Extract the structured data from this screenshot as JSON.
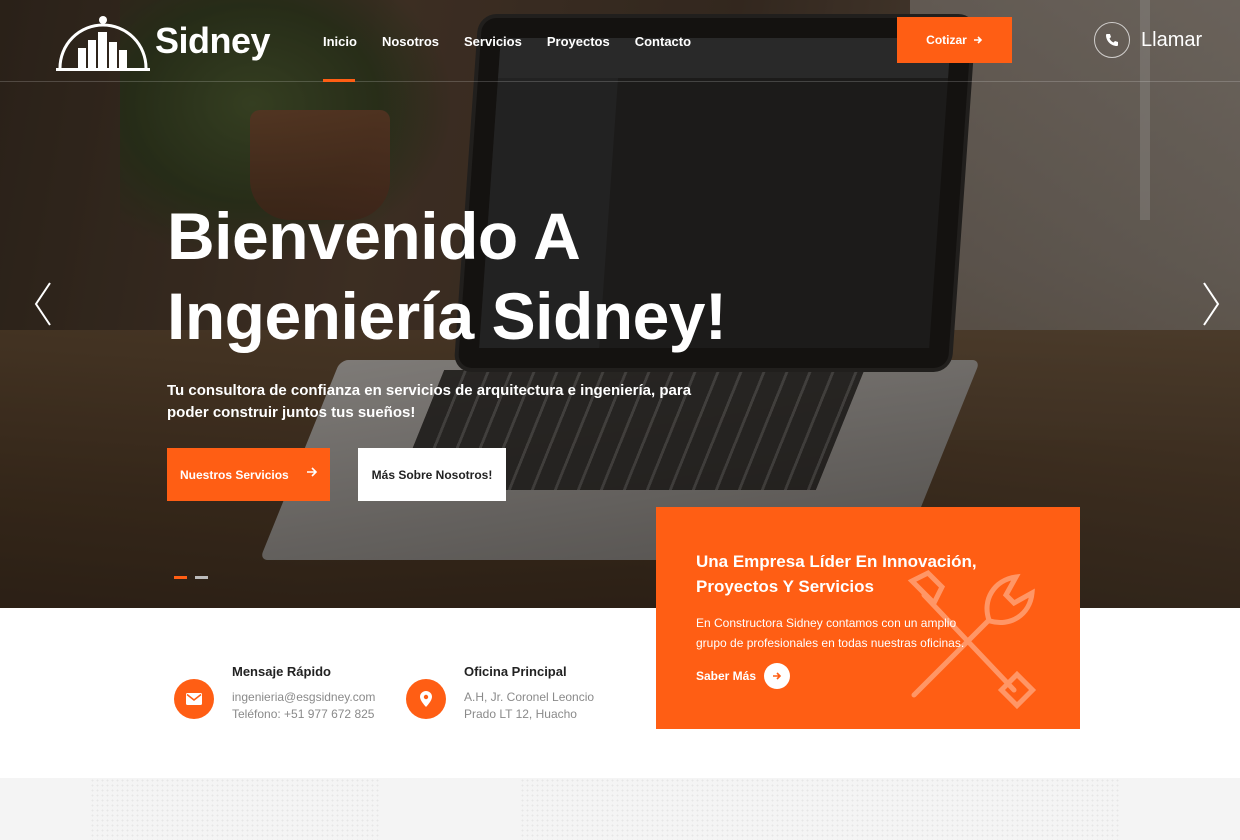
{
  "header": {
    "brand": "Sidney",
    "nav": [
      {
        "label": "Inicio",
        "active": true
      },
      {
        "label": "Nosotros",
        "active": false
      },
      {
        "label": "Servicios",
        "active": false
      },
      {
        "label": "Proyectos",
        "active": false
      },
      {
        "label": "Contacto",
        "active": false
      }
    ],
    "quote_button": "Cotizar",
    "call_label": "Llamar",
    "icons": {
      "logo": "city-skyline-logo",
      "call": "phone-icon",
      "quote_arrow": "arrow-right-icon"
    }
  },
  "hero": {
    "title_line1": "Bienvenido A",
    "title_line2": "Ingeniería Sidney!",
    "subtitle": "Tu consultora de confianza en servicios de arquitectura e ingeniería, para poder construir juntos tus sueños!",
    "primary_button": "Nuestros Servicios",
    "secondary_button": "Más Sobre Nosotros!",
    "slides_total": 2,
    "slide_active": 1
  },
  "card": {
    "title": "Una Empresa Líder En Innovación, Proyectos Y Servicios",
    "text": "En Constructora Sidney contamos con un amplio grupo de profesionales en todas nuestras oficinas.",
    "link": "Saber Más",
    "icon": "tools-icon"
  },
  "info": {
    "message": {
      "title": "Mensaje Rápido",
      "line1": "ingenieria@esgsidney.com",
      "line2": "Teléfono: +51 977 672 825",
      "icon": "mail-icon"
    },
    "office": {
      "title": "Oficina Principal",
      "line1": "A.H, Jr. Coronel Leoncio",
      "line2": "Prado LT 12, Huacho",
      "icon": "location-pin-icon"
    }
  },
  "colors": {
    "accent": "#ff5e14",
    "white": "#ffffff",
    "muted_text": "#8a8a8a"
  }
}
